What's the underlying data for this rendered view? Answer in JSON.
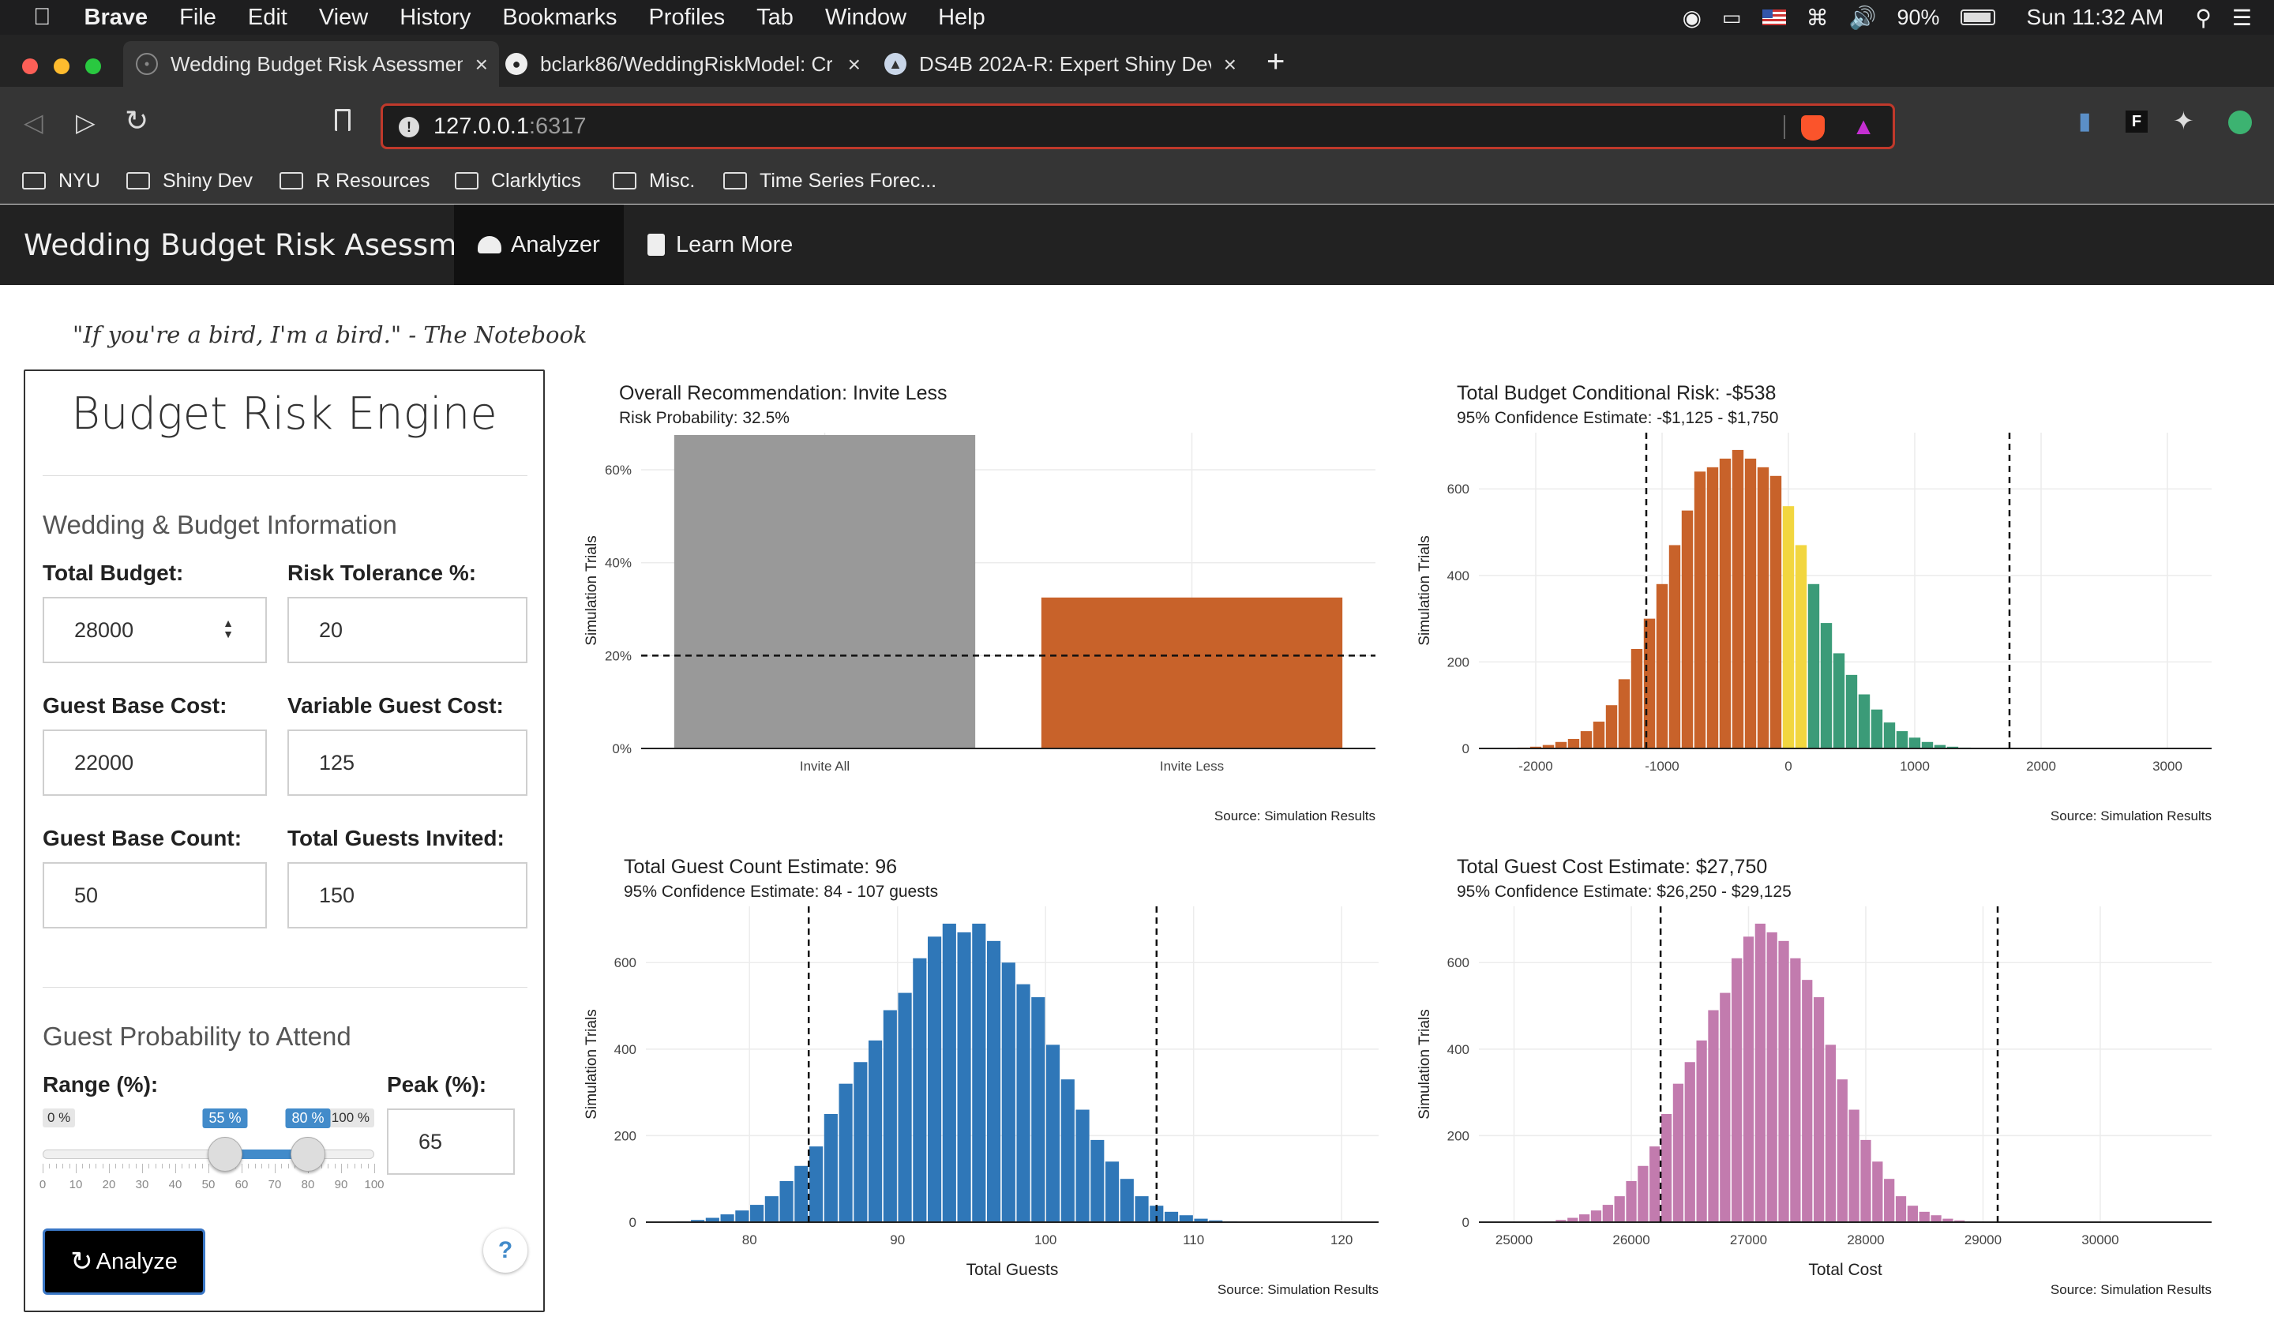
{
  "menubar": {
    "app": "Brave",
    "items": [
      "File",
      "Edit",
      "View",
      "History",
      "Bookmarks",
      "Profiles",
      "Tab",
      "Window",
      "Help"
    ],
    "battery": "90%",
    "clock": "Sun 11:32 AM"
  },
  "tabs": [
    {
      "title": "Wedding Budget Risk Asessmen",
      "active": true
    },
    {
      "title": "bclark86/WeddingRiskModel: Cr"
    },
    {
      "title": "DS4B 202A-R: Expert Shiny Dev"
    }
  ],
  "address": {
    "host": "127.0.0.1",
    "port": ":6317"
  },
  "bookmarks": [
    "NYU",
    "Shiny Dev",
    "R Resources",
    "Clarklytics",
    "Misc.",
    "Time Series Forec..."
  ],
  "app": {
    "brand": "Wedding Budget Risk Asessment",
    "nav": [
      "Analyzer",
      "Learn More"
    ],
    "quote": "\"If you're a bird, I'm a bird.\" - The Notebook"
  },
  "panel": {
    "title": "Budget Risk Engine",
    "section1": "Wedding & Budget Information",
    "total_budget_label": "Total Budget:",
    "total_budget": "28000",
    "risk_tol_label": "Risk Tolerance %:",
    "risk_tol": "20",
    "guest_base_cost_label": "Guest Base Cost:",
    "guest_base_cost": "22000",
    "var_guest_cost_label": "Variable Guest Cost:",
    "var_guest_cost": "125",
    "guest_base_count_label": "Guest Base Count:",
    "guest_base_count": "50",
    "total_invited_label": "Total Guests Invited:",
    "total_invited": "150",
    "section2": "Guest Probability to Attend",
    "range_label": "Range (%):",
    "range_min": "0 %",
    "range_max": "100 %",
    "range_from": "55 %",
    "range_to": "80 %",
    "range_from_value": 55,
    "range_to_value": 80,
    "slider_ticks": [
      "0",
      "10",
      "20",
      "30",
      "40",
      "50",
      "60",
      "70",
      "80",
      "90",
      "100"
    ],
    "peak_label": "Peak (%):",
    "peak": "65",
    "analyze": "Analyze",
    "help": "?"
  },
  "chart_data": [
    {
      "type": "bar",
      "title": "Overall Recommendation: Invite Less",
      "subtitle": "Risk Probability: 32.5%",
      "ylabel": "Simulation Trials",
      "categories": [
        "Invite All",
        "Invite Less"
      ],
      "values": [
        0.675,
        0.325
      ],
      "colors": [
        "#999999",
        "#C8622A"
      ],
      "threshold": 0.2,
      "yticks": [
        "0%",
        "20%",
        "40%",
        "60%"
      ],
      "ylim": [
        0,
        0.68
      ],
      "caption": "Source: Simulation Results"
    },
    {
      "type": "bar",
      "title": "Total Budget Conditional Risk: -$538",
      "subtitle": "95% Confidence Estimate: -$1,125 - $1,750",
      "ylabel": "Simulation Trials",
      "xlabel": "",
      "xticks": [
        -2000,
        -1000,
        0,
        1000,
        2000,
        3000
      ],
      "yticks": [
        0,
        200,
        400,
        600
      ],
      "xlim": [
        -2450,
        3350
      ],
      "ylim": [
        0,
        730
      ],
      "binwidth": 100,
      "bin_start": -2250,
      "values": [
        1,
        2,
        4,
        8,
        15,
        22,
        40,
        62,
        100,
        160,
        230,
        300,
        380,
        470,
        550,
        640,
        650,
        670,
        690,
        670,
        650,
        630,
        560,
        470,
        380,
        290,
        220,
        170,
        125,
        90,
        60,
        40,
        25,
        15,
        8,
        4,
        2,
        1
      ],
      "ci": [
        -1125,
        1750
      ],
      "colors": {
        "loss": "#C8622A",
        "near": "#F2D63F",
        "gain": "#3B9B78"
      },
      "caption": "Source: Simulation Results"
    },
    {
      "type": "bar",
      "title": "Total Guest Count Estimate: 96",
      "subtitle": "95% Confidence Estimate: 84 - 107 guests",
      "ylabel": "Simulation Trials",
      "xlabel": "Total Guests",
      "xticks": [
        80,
        90,
        100,
        110,
        120
      ],
      "yticks": [
        0,
        200,
        400,
        600
      ],
      "xlim": [
        73,
        122.5
      ],
      "ylim": [
        0,
        730
      ],
      "binwidth": 1,
      "bin_start": 75,
      "values": [
        2,
        5,
        10,
        18,
        27,
        40,
        60,
        95,
        130,
        175,
        250,
        320,
        370,
        420,
        490,
        530,
        610,
        660,
        690,
        670,
        690,
        650,
        600,
        550,
        520,
        410,
        330,
        260,
        190,
        140,
        100,
        60,
        38,
        24,
        16,
        8,
        4,
        2
      ],
      "ci": [
        84,
        107.5
      ],
      "color": "#2F77B8",
      "caption": "Source: Simulation Results"
    },
    {
      "type": "bar",
      "title": "Total Guest Cost Estimate: $27,750",
      "subtitle": "95% Confidence Estimate: $26,250 - $29,125",
      "ylabel": "Simulation Trials",
      "xlabel": "Total Cost",
      "xticks": [
        25000,
        26000,
        27000,
        28000,
        29000,
        30000
      ],
      "yticks": [
        0,
        200,
        400,
        600
      ],
      "xlim": [
        24700,
        30950
      ],
      "ylim": [
        0,
        730
      ],
      "binwidth": 100,
      "bin_start": 25250,
      "values": [
        2,
        5,
        10,
        18,
        27,
        40,
        60,
        95,
        130,
        175,
        250,
        320,
        370,
        420,
        490,
        530,
        610,
        660,
        690,
        670,
        650,
        610,
        560,
        520,
        410,
        330,
        260,
        190,
        140,
        100,
        60,
        38,
        24,
        16,
        8,
        4,
        2
      ],
      "ci": [
        26250,
        29125
      ],
      "color": "#C27BAE",
      "caption": "Source: Simulation Results"
    }
  ]
}
